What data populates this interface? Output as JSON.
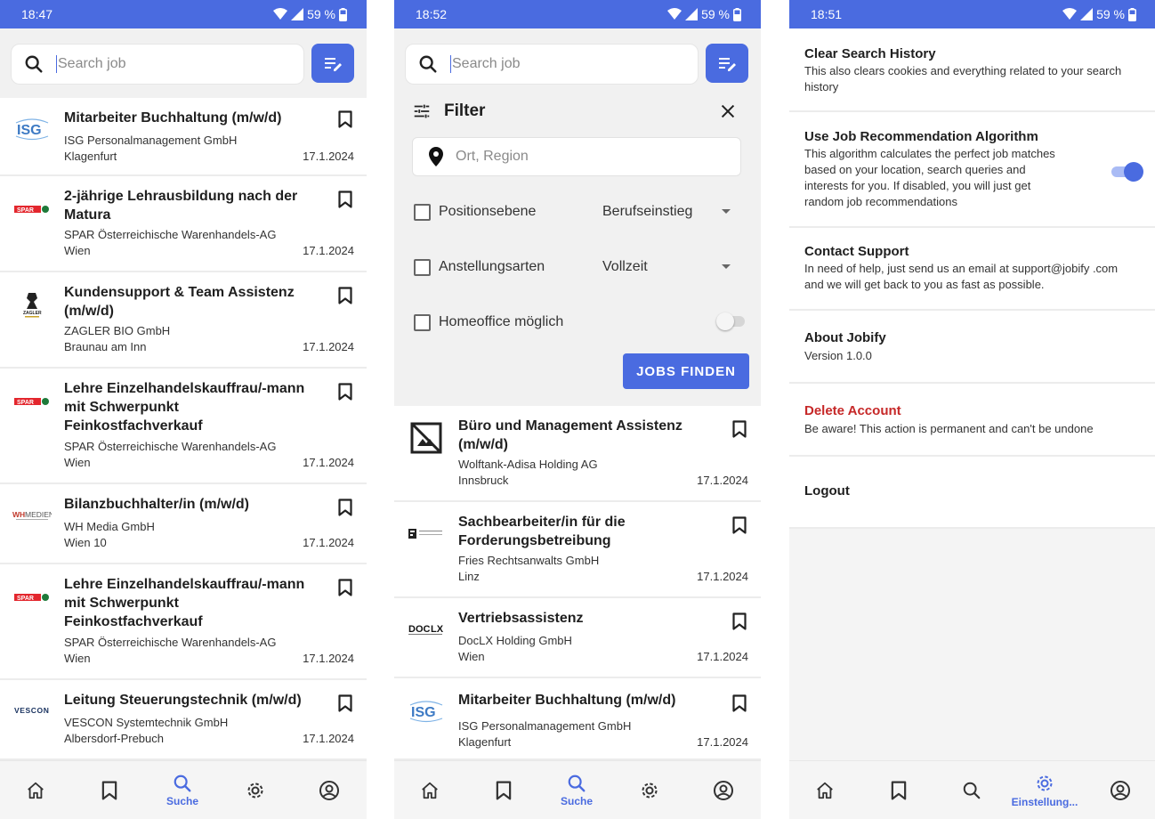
{
  "screen1": {
    "status": {
      "time": "18:47",
      "battery": "59 %"
    },
    "search": {
      "placeholder": "Search job"
    },
    "jobs": [
      {
        "logo": "ISG",
        "title": "Mitarbeiter Buchhaltung (m/w/d)",
        "company": "ISG Personalmanagement GmbH",
        "location": "Klagenfurt",
        "date": "17.1.2024"
      },
      {
        "logo": "SPAR",
        "title": "2-jährige Lehrausbildung nach der Matura",
        "company": "SPAR Österreichische Warenhandels-AG",
        "location": "Wien",
        "date": "17.1.2024"
      },
      {
        "logo": "ZAGLER",
        "title": "Kundensupport & Team Assistenz (m/w/d)",
        "company": "ZAGLER BIO GmbH",
        "location": "Braunau am Inn",
        "date": "17.1.2024"
      },
      {
        "logo": "SPAR",
        "title": "Lehre Einzelhandelskauffrau/-mann mit Schwerpunkt Feinkostfachverkauf",
        "company": "SPAR Österreichische Warenhandels-AG",
        "location": "Wien",
        "date": "17.1.2024"
      },
      {
        "logo": "WHMEDIEN",
        "title": "Bilanzbuchhalter/in (m/w/d)",
        "company": "WH Media GmbH",
        "location": "Wien 10",
        "date": "17.1.2024"
      },
      {
        "logo": "SPAR",
        "title": "Lehre Einzelhandelskauffrau/-mann mit Schwerpunkt Feinkostfachverkauf",
        "company": "SPAR Österreichische Warenhandels-AG",
        "location": "Wien",
        "date": "17.1.2024"
      },
      {
        "logo": "VESCON",
        "title": "Leitung Steuerungstechnik (m/w/d)",
        "company": "VESCON Systemtechnik GmbH",
        "location": "Albersdorf-Prebuch",
        "date": "17.1.2024"
      }
    ],
    "nav": {
      "active_label": "Suche"
    }
  },
  "screen2": {
    "status": {
      "time": "18:52",
      "battery": "59 %"
    },
    "search": {
      "placeholder": "Search job"
    },
    "filter": {
      "title": "Filter",
      "location_placeholder": "Ort, Region",
      "position_label": "Positionsebene",
      "position_value": "Berufseinstieg",
      "employment_label": "Anstellungsarten",
      "employment_value": "Vollzeit",
      "homeoffice_label": "Homeoffice möglich",
      "find_button": "JOBS FINDEN"
    },
    "jobs": [
      {
        "logo": "placeholder",
        "title": "Büro und Management Assistenz (m/w/d)",
        "company": "Wolftank-Adisa Holding AG",
        "location": "Innsbruck",
        "date": "17.1.2024"
      },
      {
        "logo": "FRIES",
        "title": "Sachbearbeiter/in für die Forderungsbetreibung",
        "company": "Fries Rechtsanwalts GmbH",
        "location": "Linz",
        "date": "17.1.2024"
      },
      {
        "logo": "DOCLX",
        "title": "Vertriebsassistenz",
        "company": "DocLX Holding GmbH",
        "location": "Wien",
        "date": "17.1.2024"
      },
      {
        "logo": "ISG",
        "title": "Mitarbeiter Buchhaltung (m/w/d)",
        "company": "ISG Personalmanagement GmbH",
        "location": "Klagenfurt",
        "date": "17.1.2024"
      }
    ],
    "nav": {
      "active_label": "Suche"
    }
  },
  "screen3": {
    "status": {
      "time": "18:51",
      "battery": "59 %"
    },
    "settings": [
      {
        "title": "Clear Search History",
        "desc": "This also clears cookies and everything related to your search history"
      },
      {
        "title": "Use Job Recommendation Algorithm",
        "desc": "This algorithm calculates the perfect job matches based on your location, search queries and interests for you. If disabled, you will just get random job recommendations",
        "toggle": true
      },
      {
        "title": "Contact Support",
        "desc": "In need of help, just send us an email at support@jobify .com and we will get back to you as fast as possible."
      },
      {
        "title": "About Jobify",
        "desc": "Version 1.0.0"
      },
      {
        "title": "Delete Account",
        "desc": "Be aware! This action is permanent and can't be undone",
        "color": "#c62828"
      },
      {
        "title": "Logout",
        "desc": ""
      }
    ],
    "nav": {
      "active_label": "Einstellung..."
    }
  },
  "colors": {
    "accent": "#4a6be0",
    "danger": "#c62828"
  }
}
